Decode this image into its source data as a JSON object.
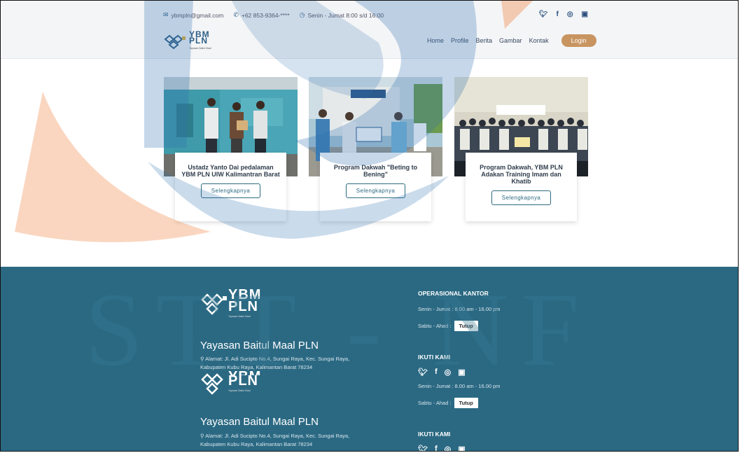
{
  "header": {
    "email": "ybmpln@gmail.com",
    "phone": "+62 853-9364-****",
    "hours": "Senin - Jumat 8:00 s/d 16:00",
    "social": {
      "twitter": "𝕏",
      "facebook": "f",
      "instagram": "◎",
      "youtube": "▶"
    },
    "logo": {
      "line1": "YBM",
      "line2": "PLN",
      "tagline": "Yayasan Baitul Maal"
    },
    "nav": [
      "Home",
      "Profile",
      "Berita",
      "Gambar",
      "Kontak"
    ],
    "login_label": "Login"
  },
  "cards": [
    {
      "title": "Ustadz Yanto Dai pedalaman YBM PLN UIW Kalimantran Barat",
      "button": "Selengkapnya"
    },
    {
      "title": "Program Dakwah \"Beting to Bening\"",
      "button": "Selengkapnya"
    },
    {
      "title": "Program Dakwah, YBM PLN Adakan Training Imam dan Khatib",
      "button": "Selengkapnya"
    }
  ],
  "footer": {
    "blocks": [
      {
        "logo": {
          "line1": "YBM",
          "line2": "PLN",
          "tagline": "Yayasan Baitul Maal"
        },
        "org_name": "Yayasan Baitul Maal PLN",
        "address": "Alamat: Jl. Adi Sucipto No.4, Sungai Raya, Kec. Sungai Raya, Kabupaten Kubu Raya, Kalimantan Barat 78234"
      },
      {
        "logo": {
          "line1": "YBM",
          "line2": "PLN",
          "tagline": "Yayasan Baitul Maal"
        },
        "org_name": "Yayasan Baitul Maal PLN",
        "address": "Alamat: Jl. Adi Sucipto No.4, Sungai Raya, Kec. Sungai Raya, Kabupaten Kubu Raya, Kalimantan Barat 78234"
      }
    ],
    "operasional_heading": "OPERASIONAL KANTOR",
    "weekday_hours": "Senin - Jumat : 8.00 am - 16.00 pm",
    "weekend_label": "Sabtu - Ahad :",
    "weekend_status": "Tutup",
    "follow_heading": "IKUTI KAMI",
    "follow_heading_2": "IKUTI KAMI"
  },
  "watermark": {
    "text": "STT - NF"
  },
  "colors": {
    "footer_bg": "#2b6983",
    "accent_orange": "#c89561",
    "primary_blue": "#2f5f86"
  }
}
